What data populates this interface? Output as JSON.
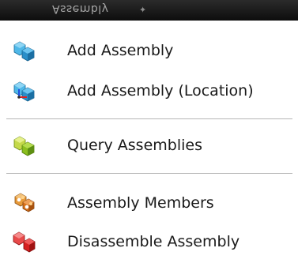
{
  "menu": {
    "title": "Assembly",
    "items": [
      {
        "label": "Add Assembly",
        "icon": "add-assembly-icon",
        "color": "#2a8fc9"
      },
      {
        "label": "Add Assembly (Location)",
        "icon": "add-assembly-location-icon",
        "color": "#2a8fc9"
      },
      {
        "label": "Query Assemblies",
        "icon": "query-assemblies-icon",
        "color": "#8bbf1e"
      },
      {
        "label": "Assembly Members",
        "icon": "assembly-members-icon",
        "color": "#d9731c"
      },
      {
        "label": "Disassemble Assembly",
        "icon": "disassemble-assembly-icon",
        "color": "#d62020"
      }
    ]
  }
}
